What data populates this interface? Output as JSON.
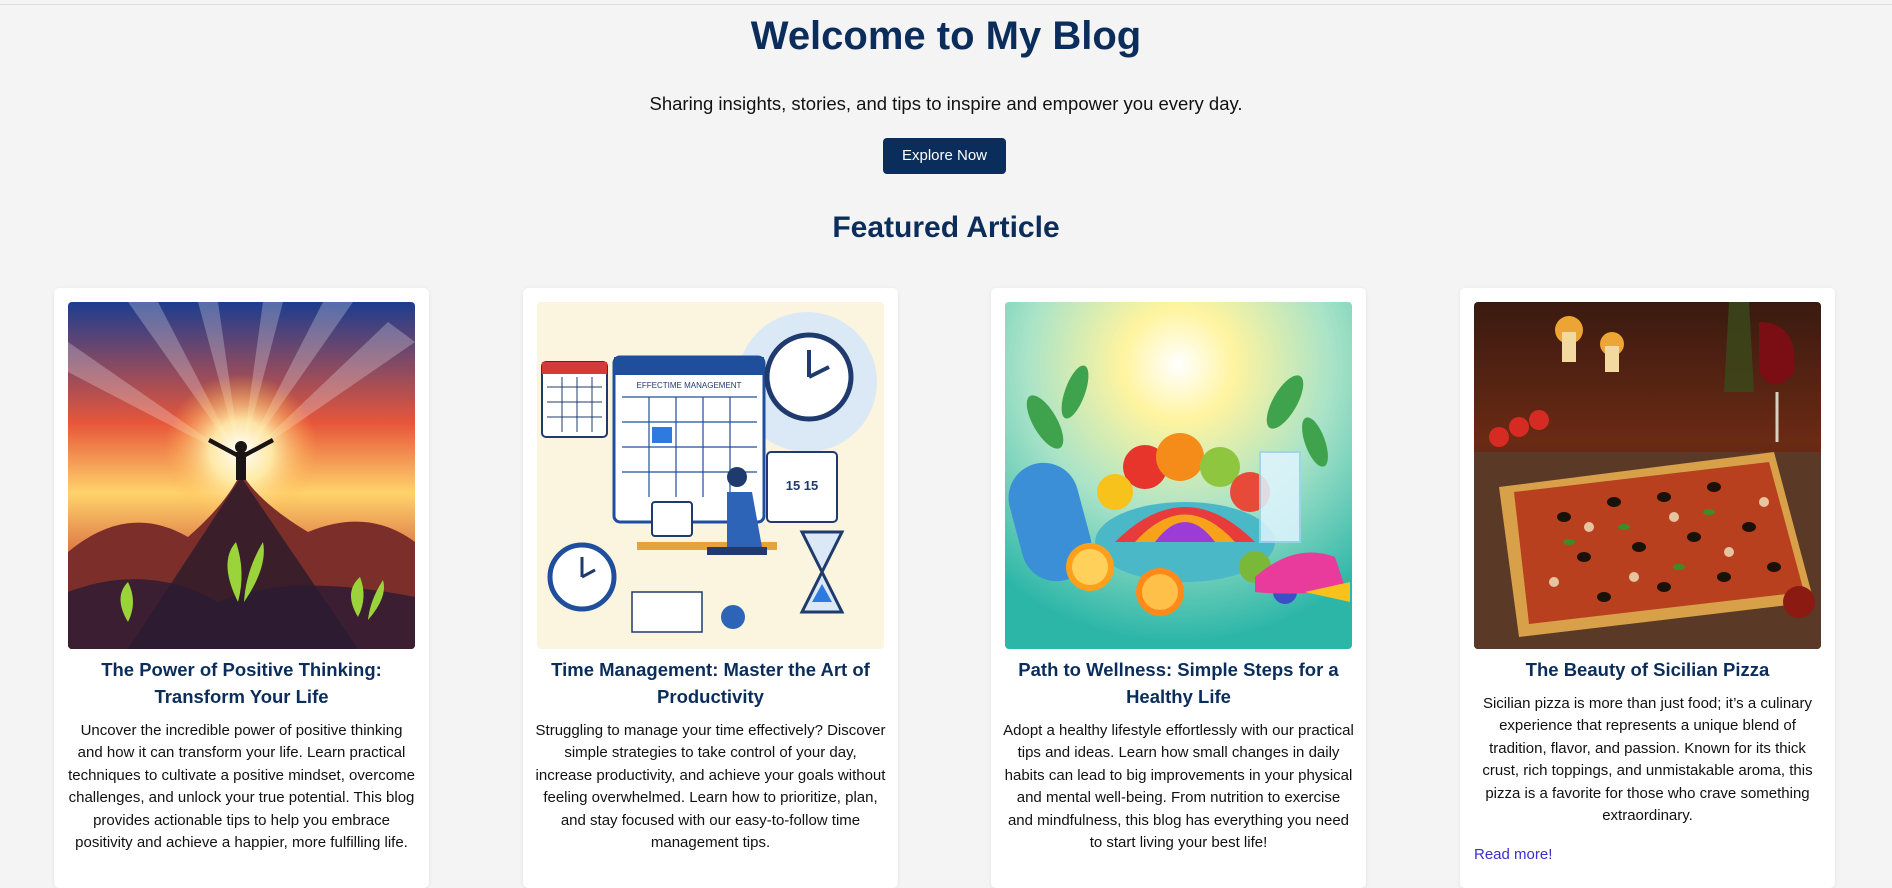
{
  "hero": {
    "title": "Welcome to My Blog",
    "subtitle": "Sharing insights, stories, and tips to inspire and empower you every day.",
    "button_label": "Explore Now"
  },
  "featured_heading": "Featured Article",
  "colors": {
    "primary": "#0b2d5b",
    "link": "#3b2fc9",
    "background": "#f4f4f4"
  },
  "cards": [
    {
      "title": "The Power of Positive Thinking: Transform Your Life",
      "text": "Uncover the incredible power of positive thinking and how it can transform your life. Learn practical techniques to cultivate a positive mindset, overcome challenges, and unlock your true potential. This blog provides actionable tips to help you embrace positivity and achieve a happier, more fulfilling life.",
      "image": "sunrise-mountain-person-illustration"
    },
    {
      "title": "Time Management: Master the Art of Productivity",
      "text": "Struggling to manage your time effectively? Discover simple strategies to take control of your day, increase productivity, and achieve your goals without feeling overwhelmed. Learn how to prioritize, plan, and stay focused with our easy-to-follow time management tips.",
      "image": "time-management-calendar-clock-illustration",
      "image_text": "EFFECTIME MANAGEMENT"
    },
    {
      "title": "Path to Wellness: Simple Steps for a Healthy Life",
      "text": "Adopt a healthy lifestyle effortlessly with our practical tips and ideas. Learn how small changes in daily habits can lead to big improvements in your physical and mental well-being. From nutrition to exercise and mindfulness, this blog has everything you need to start living your best life!",
      "image": "healthy-fruits-wellness-illustration"
    },
    {
      "title": "The Beauty of Sicilian Pizza",
      "text": "Sicilian pizza is more than just food; it’s a culinary experience that represents a unique blend of tradition, flavor, and passion. Known for its thick crust, rich toppings, and unmistakable aroma, this pizza is a favorite for those who crave something extraordinary.",
      "image": "sicilian-pizza-photo",
      "read_more": "Read more!"
    }
  ]
}
